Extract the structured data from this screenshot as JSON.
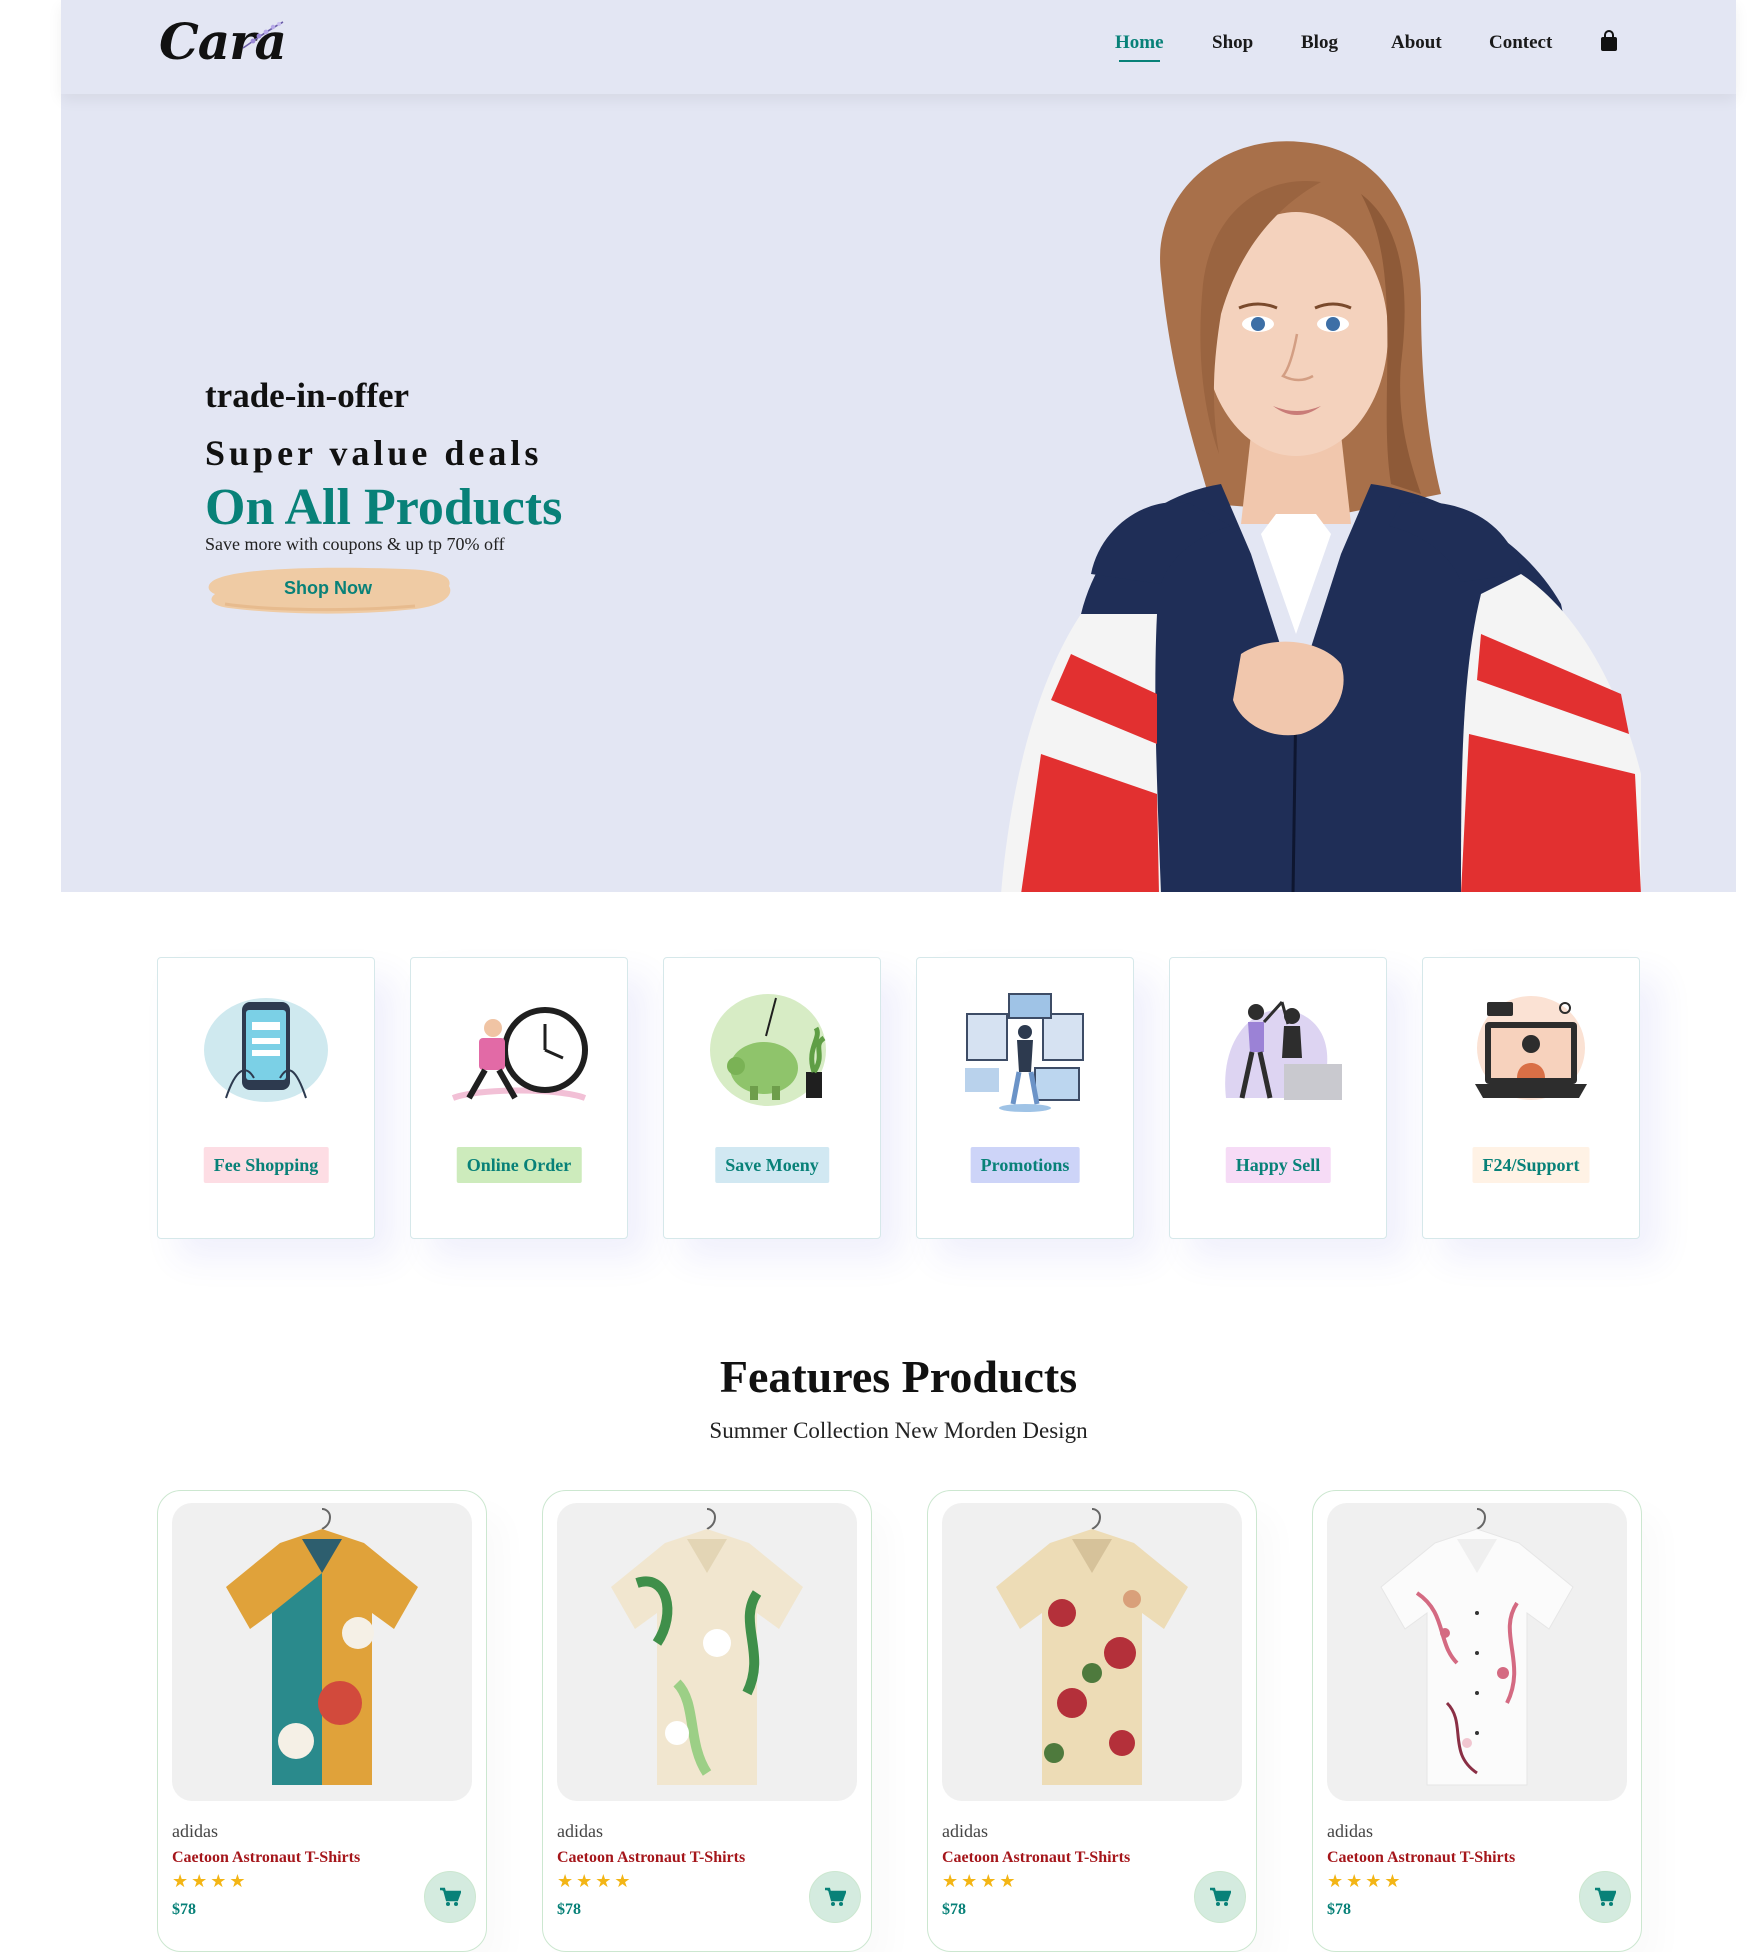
{
  "brand": {
    "logo_text": "Cara"
  },
  "nav": {
    "items": [
      {
        "label": "Home",
        "active": true
      },
      {
        "label": "Shop"
      },
      {
        "label": "Blog"
      },
      {
        "label": "About"
      },
      {
        "label": "Contect"
      }
    ],
    "cart_icon": "shopping-bag-icon"
  },
  "hero": {
    "eyebrow": "trade-in-offer",
    "subtitle": "Super value deals",
    "title": "On All Products",
    "text": "Save more with coupons & up tp 70% off",
    "button_label": "Shop Now"
  },
  "features": [
    {
      "label": "Fee Shopping",
      "bg": "#fddde4",
      "icon": "phone-shopping-illustration"
    },
    {
      "label": "Online Order",
      "bg": "#cdebbc",
      "icon": "delivery-clock-illustration"
    },
    {
      "label": "Save Moeny",
      "bg": "#d1e8f2",
      "icon": "piggy-bank-illustration"
    },
    {
      "label": "Promotions",
      "bg": "#cdd4f8",
      "icon": "promotions-illustration"
    },
    {
      "label": "Happy Sell",
      "bg": "#f6dbf6",
      "icon": "happy-sell-illustration"
    },
    {
      "label": "F24/Support",
      "bg": "#fff2e5",
      "icon": "laptop-support-illustration"
    }
  ],
  "products_section": {
    "title": "Features Products",
    "subtitle": "Summer Collection New Morden Design",
    "items": [
      {
        "brand": "adidas",
        "name": "Caetoon Astronaut T-Shirts",
        "rating": 4,
        "stars": "★★★★",
        "price": "$78",
        "colors": [
          "#e0a23a",
          "#2a8a8c",
          "#d24a3c",
          "#f5f0e6"
        ]
      },
      {
        "brand": "adidas",
        "name": "Caetoon Astronaut T-Shirts",
        "rating": 4,
        "stars": "★★★★",
        "price": "$78",
        "colors": [
          "#f1e6cf",
          "#3f8f4a",
          "#9ccf86",
          "#ffffff"
        ]
      },
      {
        "brand": "adidas",
        "name": "Caetoon Astronaut T-Shirts",
        "rating": 4,
        "stars": "★★★★",
        "price": "$78",
        "colors": [
          "#eddcb6",
          "#b4303a",
          "#4e7a3d",
          "#d9a07a"
        ]
      },
      {
        "brand": "adidas",
        "name": "Caetoon Astronaut T-Shirts",
        "rating": 4,
        "stars": "★★★★",
        "price": "$78",
        "colors": [
          "#fbfbfb",
          "#d46a82",
          "#8a2f45",
          "#f1c6d0"
        ]
      }
    ]
  },
  "colors": {
    "accent": "#088178",
    "header_bg": "#e3e6f3",
    "price": "#088178",
    "product_name": "#a5161b",
    "star": "#f3b515"
  }
}
